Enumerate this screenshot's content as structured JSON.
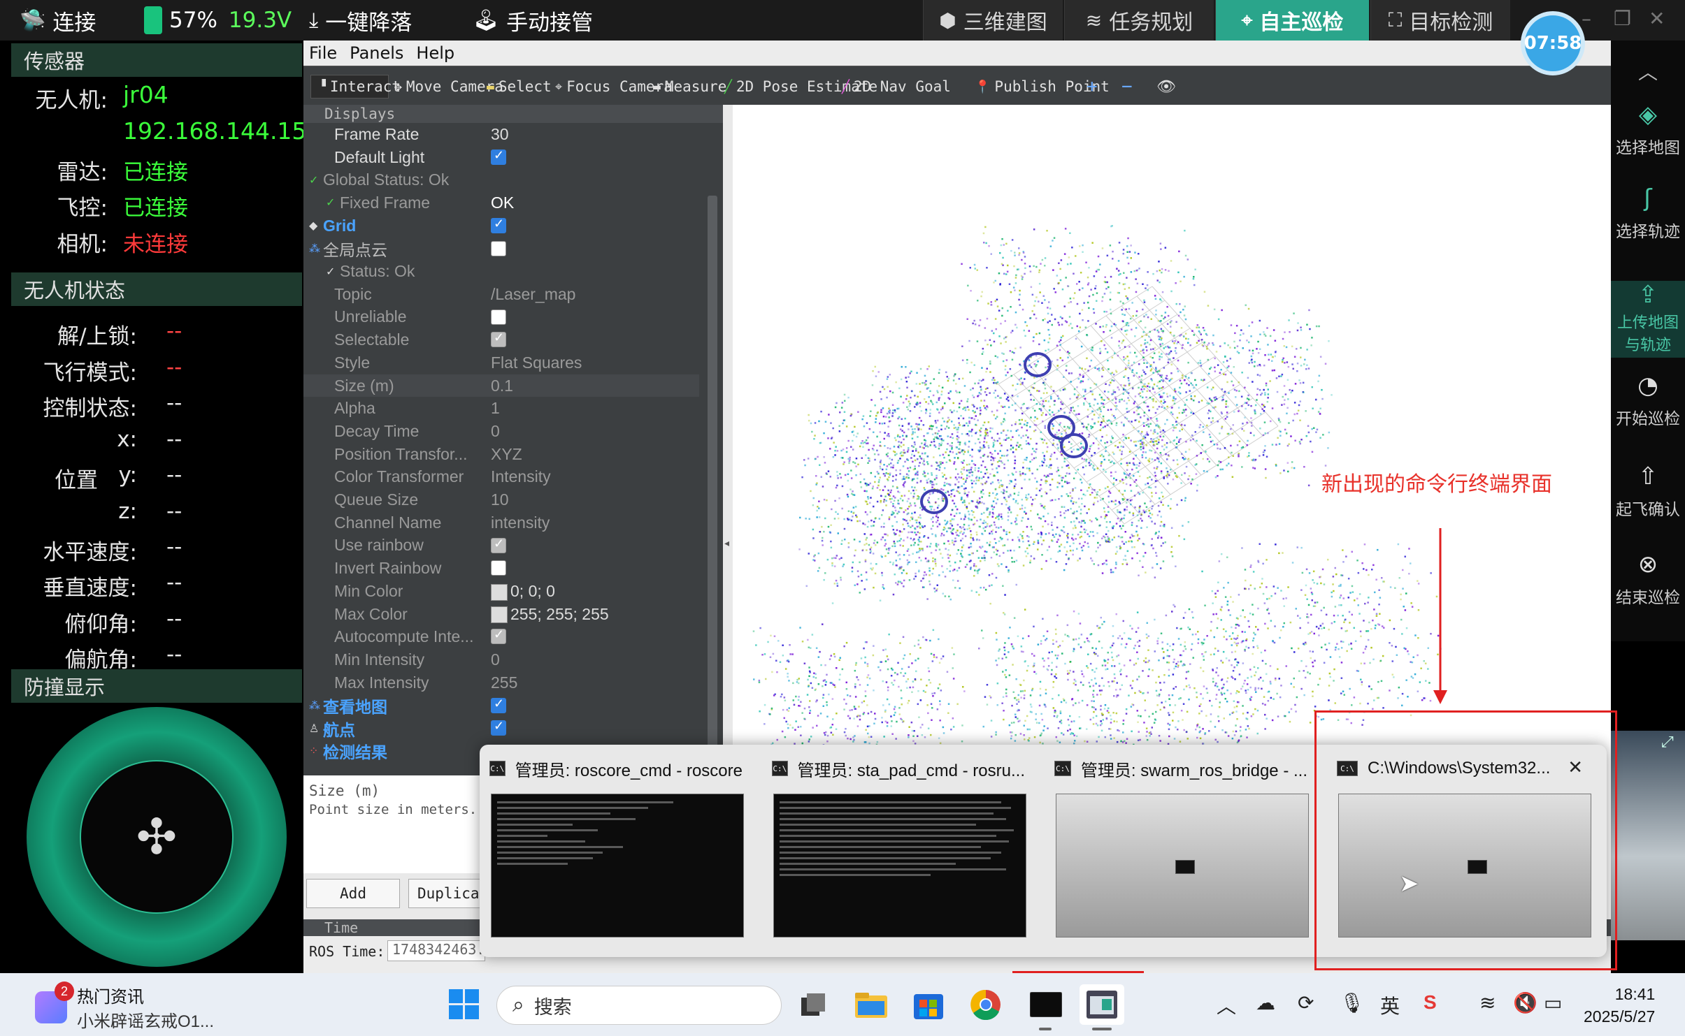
{
  "topbar": {
    "connect": "连接",
    "battery_pct": "57%",
    "battery_voltage": "19.3V",
    "land": "一键降落",
    "manual": "手动接管",
    "tabs": [
      "三维建图",
      "任务规划",
      "自主巡检",
      "目标检测"
    ],
    "active_tab": "自主巡检",
    "timer": "07:58"
  },
  "sensors": {
    "header": "传感器",
    "uav_label": "无人机:",
    "uav_name": "jr04",
    "uav_ip": "192.168.144.154",
    "lidar_label": "雷达:",
    "lidar_status": "已连接",
    "fc_label": "飞控:",
    "fc_status": "已连接",
    "camera_label": "相机:",
    "camera_status": "未连接"
  },
  "uav_state": {
    "header": "无人机状态",
    "rows": [
      {
        "label": "解/上锁:",
        "value": "--"
      },
      {
        "label": "飞行模式:",
        "value": "--"
      },
      {
        "label": "控制状态:",
        "value": "--"
      },
      {
        "label": "x:",
        "value": "--"
      },
      {
        "label": "y:",
        "value": "--"
      },
      {
        "label": "z:",
        "value": "--"
      },
      {
        "label": "水平速度:",
        "value": "--"
      },
      {
        "label": "垂直速度:",
        "value": "--"
      },
      {
        "label": "俯仰角:",
        "value": "--"
      },
      {
        "label": "偏航角:",
        "value": "--"
      }
    ],
    "position_label": "位置"
  },
  "collision": {
    "header": "防撞显示"
  },
  "rviz": {
    "menu": [
      "File",
      "Panels",
      "Help"
    ],
    "tools": [
      "Interact",
      "Move Camera",
      "Select",
      "Focus Camera",
      "Measure",
      "2D Pose Estimate",
      "2D Nav Goal",
      "Publish Point"
    ],
    "displays_header": "Displays",
    "props": [
      {
        "k": "Frame Rate",
        "v": "30"
      },
      {
        "k": "Default Light",
        "v": ""
      },
      {
        "k": "Global Status: Ok",
        "v": ""
      },
      {
        "k": "Fixed Frame",
        "v": "OK"
      },
      {
        "k": "Grid",
        "v": ""
      },
      {
        "k": "全局点云",
        "v": ""
      },
      {
        "k": "Status: Ok",
        "v": ""
      },
      {
        "k": "Topic",
        "v": "/Laser_map"
      },
      {
        "k": "Unreliable",
        "v": ""
      },
      {
        "k": "Selectable",
        "v": ""
      },
      {
        "k": "Style",
        "v": "Flat Squares"
      },
      {
        "k": "Size (m)",
        "v": "0.1"
      },
      {
        "k": "Alpha",
        "v": "1"
      },
      {
        "k": "Decay Time",
        "v": "0"
      },
      {
        "k": "Position Transfor...",
        "v": "XYZ"
      },
      {
        "k": "Color Transformer",
        "v": "Intensity"
      },
      {
        "k": "Queue Size",
        "v": "10"
      },
      {
        "k": "Channel Name",
        "v": "intensity"
      },
      {
        "k": "Use rainbow",
        "v": ""
      },
      {
        "k": "Invert Rainbow",
        "v": ""
      },
      {
        "k": "Min Color",
        "v": "0; 0; 0"
      },
      {
        "k": "Max Color",
        "v": "255; 255; 255"
      },
      {
        "k": "Autocompute Inte...",
        "v": ""
      },
      {
        "k": "Min Intensity",
        "v": "0"
      },
      {
        "k": "Max Intensity",
        "v": "255"
      },
      {
        "k": "查看地图",
        "v": ""
      },
      {
        "k": "航点",
        "v": ""
      },
      {
        "k": "检测结果",
        "v": ""
      }
    ],
    "desc_title": "Size (m)",
    "desc_text": "Point size in meters.",
    "add_btn": "Add",
    "dup_btn": "Duplica",
    "time_header": "Time",
    "ros_time_label": "ROS Time:",
    "ros_time_value": "1748342463.8"
  },
  "rightnav": [
    {
      "label": "选择地图",
      "icon": "layers-icon"
    },
    {
      "label": "选择轨迹",
      "icon": "route-icon"
    },
    {
      "label": "上传地图与轨迹",
      "icon": "upload-icon"
    },
    {
      "label": "开始巡检",
      "icon": "timer-icon"
    },
    {
      "label": "起飞确认",
      "icon": "takeoff-icon"
    },
    {
      "label": "结束巡检",
      "icon": "close-circle-icon"
    }
  ],
  "switcher": {
    "windows": [
      "管理员:  roscore_cmd - roscore",
      "管理员:  sta_pad_cmd - rosru...",
      "管理员:  swarm_ros_bridge  - ...",
      "C:\\Windows\\System32..."
    ]
  },
  "annotation": "新出现的命令行终端界面",
  "taskbar": {
    "news_title": "热门资讯",
    "news_sub": "小米辟谣玄戒O1...",
    "news_badge": "2",
    "search_placeholder": "搜索",
    "lang": "英",
    "time": "18:41",
    "date": "2025/5/27"
  },
  "colors": {
    "accent": "#2aa58b",
    "ok": "#3bff3b",
    "error": "#ff3a3a",
    "annotation": "#e02020"
  }
}
